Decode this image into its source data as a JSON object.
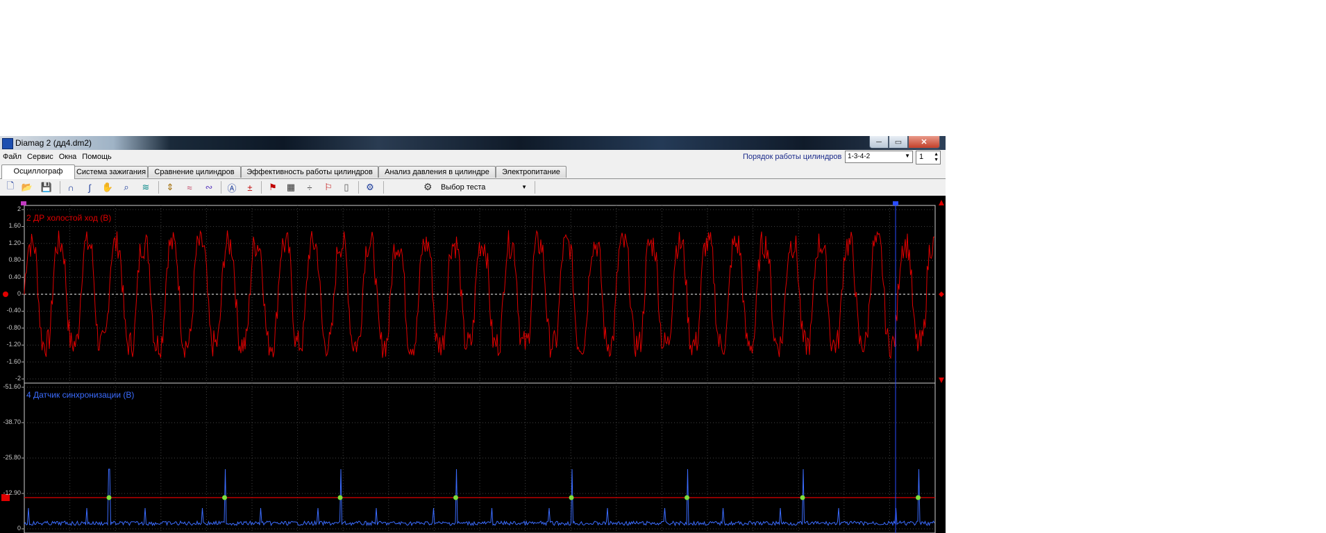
{
  "window": {
    "title": "Diamag 2 (дд4.dm2)",
    "close_label": "✕",
    "min_label": "─",
    "max_label": "▭"
  },
  "menu": {
    "items": [
      "Файл",
      "Сервис",
      "Окна",
      "Помощь"
    ]
  },
  "cylinder_order": {
    "label": "Порядок работы цилиндров",
    "value": "1-3-4-2",
    "spin_value": "1"
  },
  "tabs": [
    "Осциллограф",
    "Система зажигания",
    "Сравнение цилиндров",
    "Эффективность работы цилиндров",
    "Анализ давления в цилиндре",
    "Электропитание"
  ],
  "toolbar": {
    "icons": [
      "new-file-icon",
      "open-folder-icon",
      "save-icon",
      "curve-icon",
      "measure-icon",
      "hand-icon",
      "zoom-icon",
      "layers-icon",
      "scale-icon",
      "waves-icon",
      "compare-icon",
      "auto-gain-icon",
      "zero-icon",
      "filter-icon",
      "table-icon",
      "separator-icon",
      "flag-icon",
      "note-icon",
      "auto-settings-icon"
    ],
    "test_select_label": "Выбор теста"
  },
  "channels": [
    {
      "name": "2 ДР холостой ход (В)",
      "color": "#e00000",
      "ticks": [
        "2",
        "1.60",
        "1.20",
        "0.80",
        "0.40",
        "0",
        "-0.40",
        "-0.80",
        "-1.20",
        "-1.60",
        "-2"
      ]
    },
    {
      "name": "4 Датчик синхронизации (В)",
      "color": "#3b6cff",
      "ticks": [
        "-51.60",
        "-38.70",
        "-25.80",
        "-12.90",
        "0"
      ]
    }
  ],
  "markers": {
    "left": "1",
    "right": "2",
    "trigger": "S1"
  }
}
